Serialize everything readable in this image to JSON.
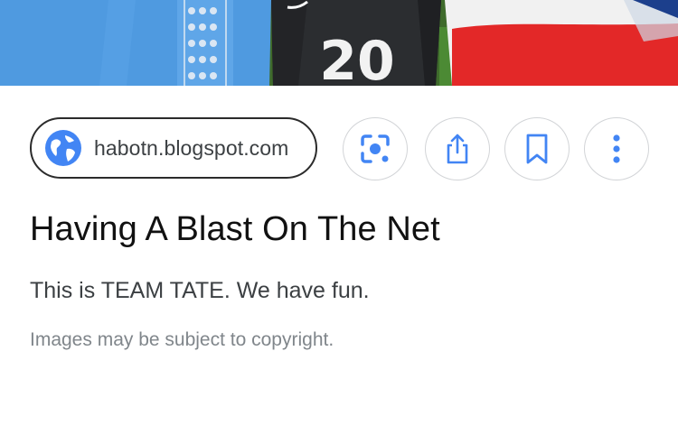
{
  "image": {
    "jersey_number": "20"
  },
  "source": {
    "domain": "habotn.blogspot.com",
    "icon": "globe-icon"
  },
  "actions": [
    {
      "name": "lens",
      "icon": "lens-icon"
    },
    {
      "name": "share",
      "icon": "share-icon"
    },
    {
      "name": "save",
      "icon": "bookmark-icon"
    },
    {
      "name": "more",
      "icon": "more-vert-icon"
    }
  ],
  "result": {
    "title": "Having A Blast On The Net",
    "description": "This is TEAM TATE. We have fun.",
    "notice": "Images may be subject to copyright."
  },
  "colors": {
    "accent": "#4285f4",
    "pill_border": "#2b2b2b",
    "circle_border": "#d2d4d7"
  }
}
